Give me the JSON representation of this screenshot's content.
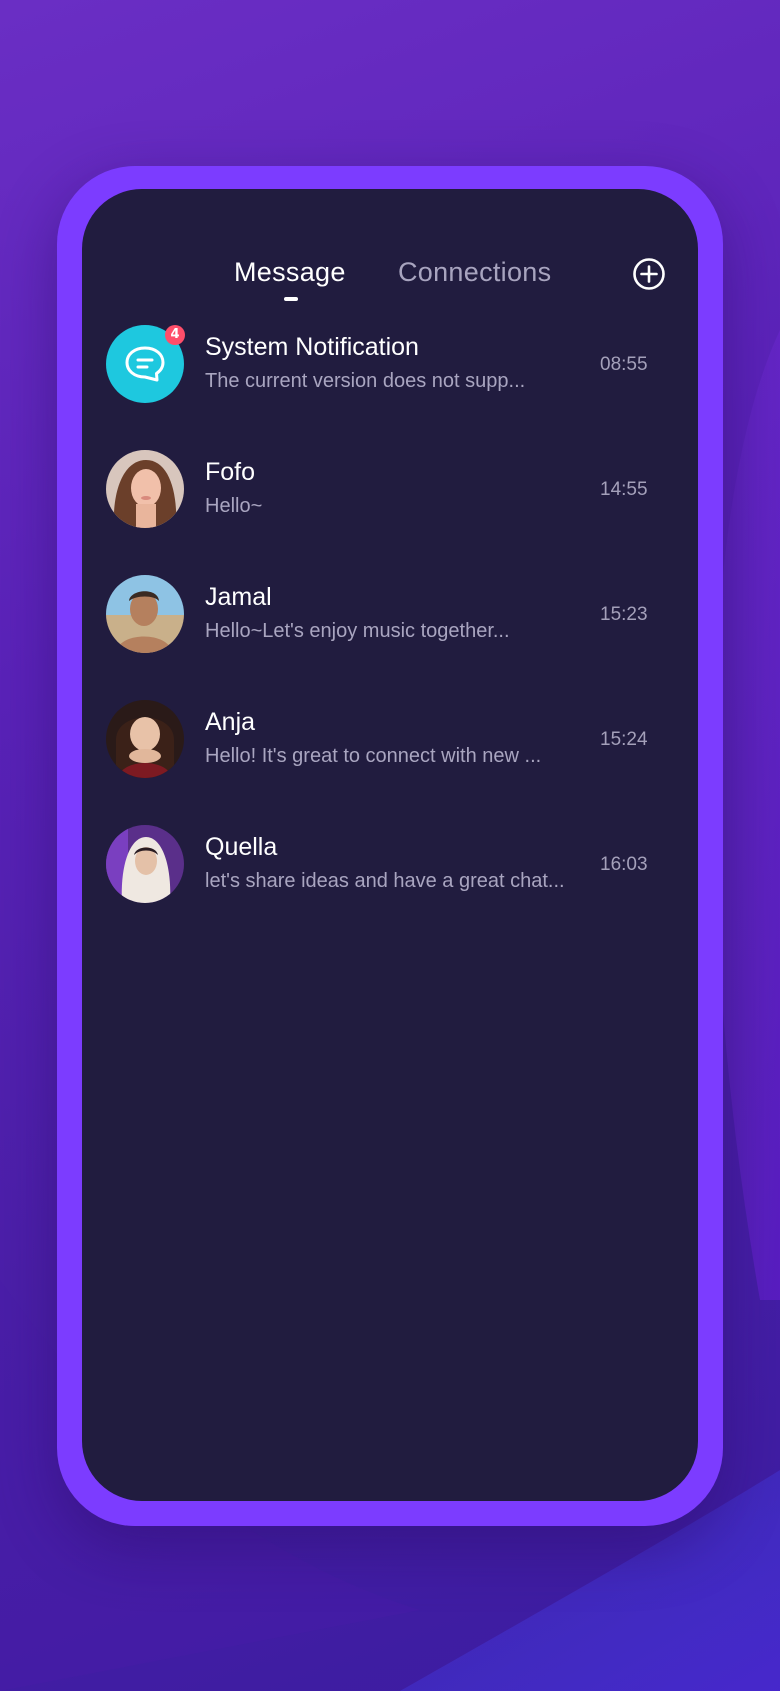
{
  "header": {
    "tabs": [
      {
        "label": "Message",
        "active": true
      },
      {
        "label": "Connections",
        "active": false
      }
    ],
    "add_icon": "plus-circle-icon"
  },
  "conversations": [
    {
      "name": "System Notification",
      "preview": "The current version does not supp...",
      "time": "08:55",
      "badge": "4",
      "avatar": "chat-bubble-icon"
    },
    {
      "name": "Fofo",
      "preview": "Hello~",
      "time": "14:55",
      "avatar": "user-photo"
    },
    {
      "name": "Jamal",
      "preview": "Hello~Let's enjoy music together...",
      "time": "15:23",
      "avatar": "user-photo"
    },
    {
      "name": "Anja",
      "preview": "Hello! It's great to connect with new ...",
      "time": "15:24",
      "avatar": "user-photo"
    },
    {
      "name": "Quella",
      "preview": " let's share ideas and have a great chat...",
      "time": "16:03",
      "avatar": "user-photo"
    }
  ],
  "colors": {
    "background": "#5a22b8",
    "frame": "#7c3cff",
    "screen": "#211c3f",
    "system_avatar": "#1ec8df",
    "badge": "#ff4e6a"
  }
}
